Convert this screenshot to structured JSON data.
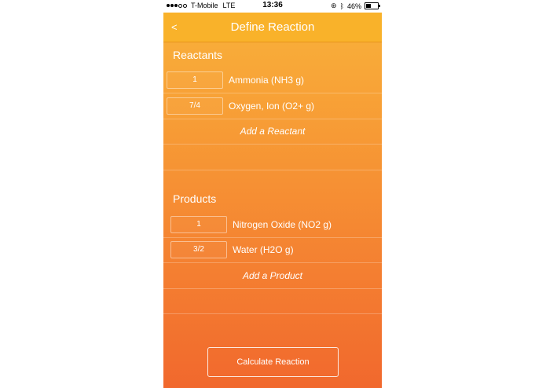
{
  "status_bar": {
    "carrier": "T-Mobile",
    "network": "LTE",
    "time": "13:36",
    "battery_percent": "46%",
    "battery_level": 0.46,
    "signal_bars_filled": 3,
    "signal_bars_total": 5
  },
  "nav": {
    "back_label": "<",
    "title": "Define Reaction"
  },
  "reactants": {
    "header": "Reactants",
    "items": [
      {
        "coefficient": "1",
        "name": "Ammonia  (NH3 g)"
      },
      {
        "coefficient": "7/4",
        "name": "Oxygen, Ion  (O2+ g)"
      }
    ],
    "add_label": "Add a Reactant"
  },
  "products": {
    "header": "Products",
    "items": [
      {
        "coefficient": "1",
        "name": "Nitrogen Oxide  (NO2 g)"
      },
      {
        "coefficient": "3/2",
        "name": "Water  (H2O g)"
      }
    ],
    "add_label": "Add a Product"
  },
  "calculate_label": "Calculate Reaction",
  "colors": {
    "nav_background": "#f9b22a",
    "gradient_top": "#f9b43b",
    "gradient_bottom": "#f1682d",
    "text": "#ffffff"
  }
}
